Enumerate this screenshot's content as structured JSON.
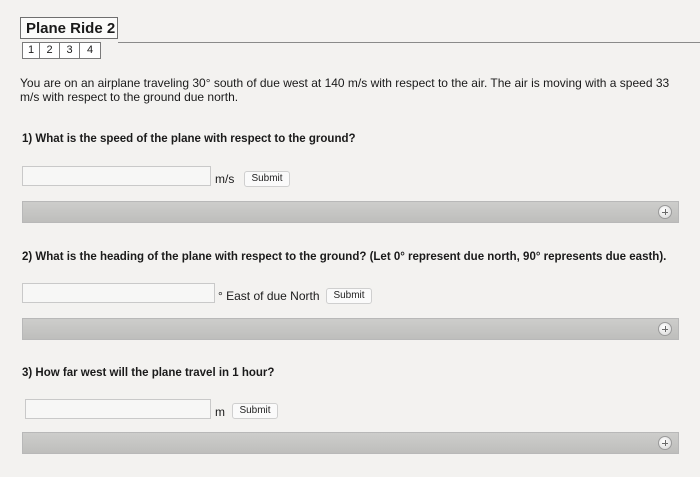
{
  "header": {
    "title": "Plane Ride 2",
    "pages": [
      "1",
      "2",
      "3",
      "4"
    ]
  },
  "problem": {
    "intro": "You are on an airplane traveling 30° south of due west at 140 m/s with respect to the air. The air is moving with a speed 33 m/s with respect to the ground due north."
  },
  "questions": [
    {
      "text": "1) What is the speed of the plane with respect to the ground?",
      "input_value": "",
      "unit": "m/s",
      "submit_label": "Submit"
    },
    {
      "text": "2) What is the heading of the plane with respect to the ground? (Let 0° represent due north, 90° represents due easth).",
      "input_value": "",
      "unit": "° East of due North",
      "submit_label": "Submit"
    },
    {
      "text": "3) How far west will the plane travel in 1 hour?",
      "input_value": "",
      "unit": "m",
      "submit_label": "Submit"
    }
  ],
  "icons": {
    "expand": "plus-circle-icon"
  }
}
